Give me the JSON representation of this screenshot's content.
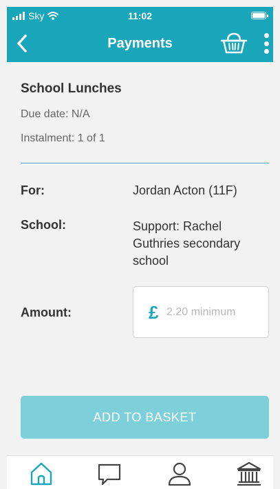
{
  "status_bar": {
    "carrier": "Sky",
    "time": "11:02"
  },
  "header": {
    "title": "Payments"
  },
  "payment": {
    "title": "School Lunches",
    "due_date": "Due date: N/A",
    "instalment": "Instalment: 1 of 1",
    "for_label": "For:",
    "for_value": "Jordan Acton (11F)",
    "school_label": "School:",
    "school_value": "Support: Rachel Guthries secondary school",
    "amount_label": "Amount:",
    "currency_symbol": "£",
    "amount_value": "",
    "amount_placeholder": "2.20 minimum"
  },
  "actions": {
    "add_to_basket": "ADD TO BASKET"
  },
  "tabbar": {
    "items": [
      {
        "icon": "home-icon"
      },
      {
        "icon": "chat-icon"
      },
      {
        "icon": "profile-icon"
      },
      {
        "icon": "bank-icon"
      }
    ]
  },
  "colors": {
    "accent": "#1aa6ba",
    "button_disabled": "#7dd0da",
    "divider": "#5aa7c8"
  }
}
